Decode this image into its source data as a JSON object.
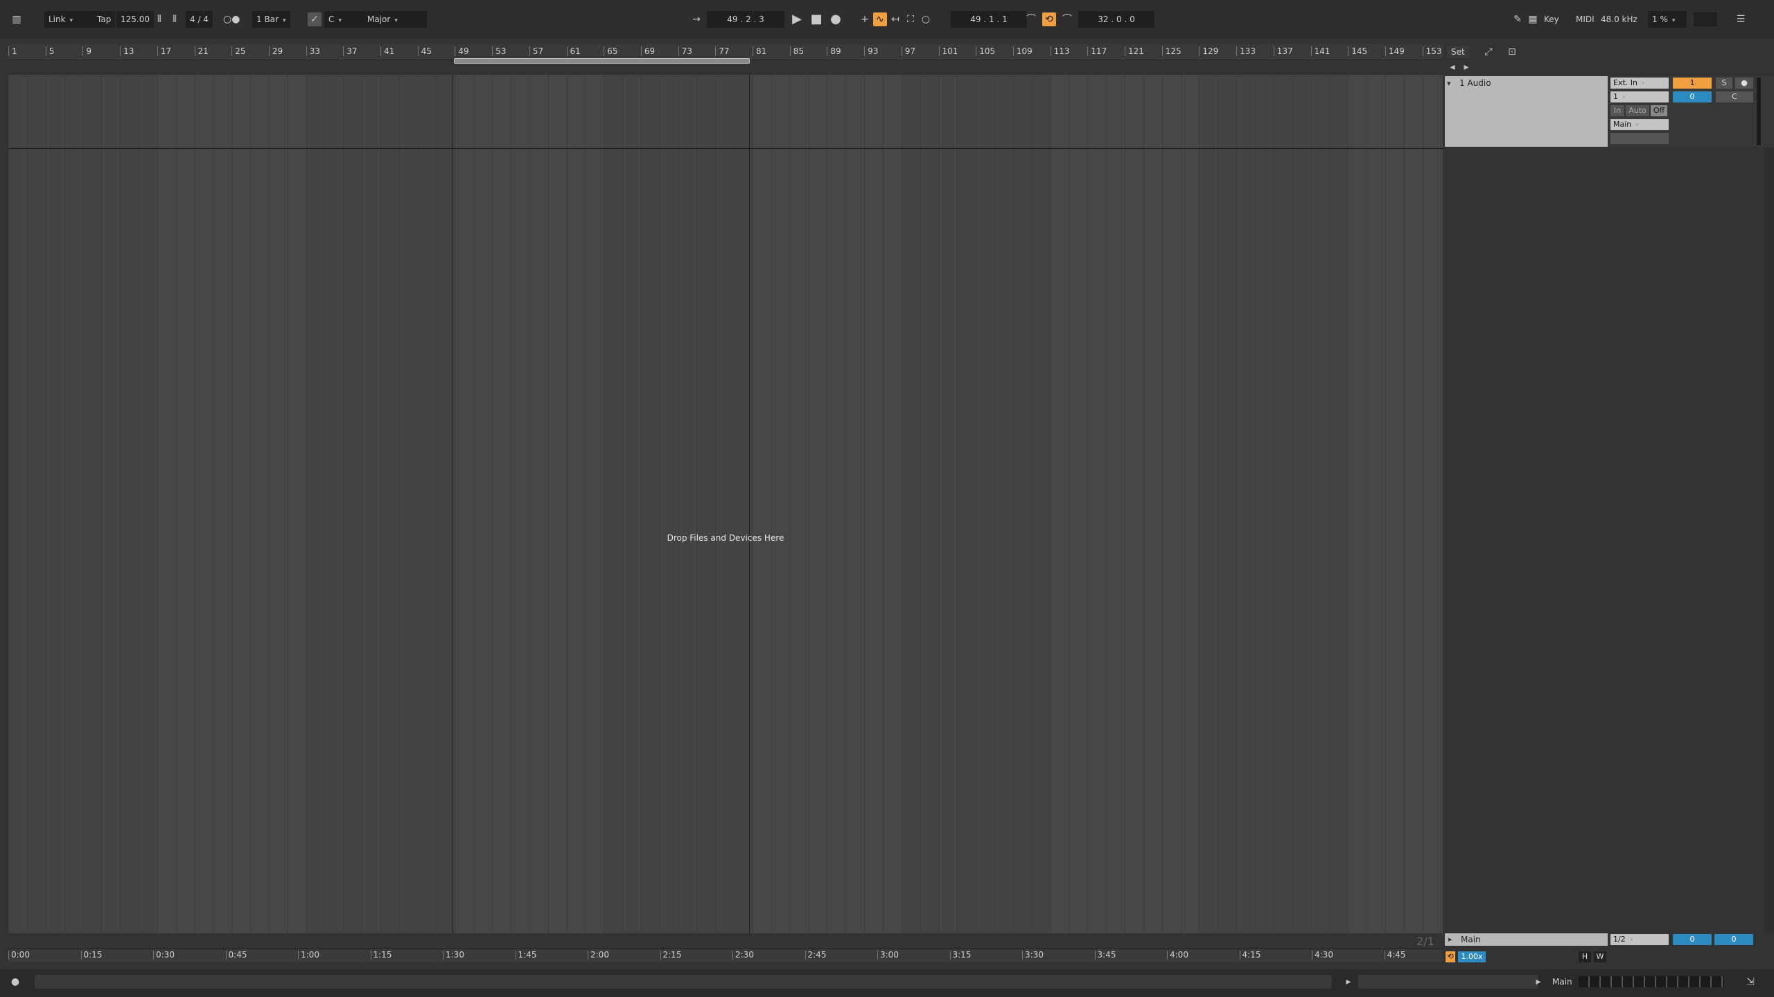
{
  "control_bar": {
    "link": "Link",
    "tap": "Tap",
    "tempo": "125.00",
    "time_signature": "4 / 4",
    "quantize": "1 Bar",
    "key_root": "C",
    "scale": "Major",
    "arrangement_position": "49 .  2 .  3",
    "loop_start": "49 .  1 .  1",
    "loop_length": "32 .  0 .  0",
    "key_map": "Key",
    "midi_map": "MIDI",
    "sample_rate": "48.0 kHz",
    "cpu": "1 %"
  },
  "ruler": {
    "bars": [
      "1",
      "5",
      "9",
      "13",
      "17",
      "21",
      "25",
      "29",
      "33",
      "37",
      "41",
      "45",
      "49",
      "53",
      "57",
      "61",
      "65",
      "69",
      "73",
      "77",
      "81",
      "85",
      "89",
      "93",
      "97",
      "101",
      "105",
      "109",
      "113",
      "117",
      "121",
      "125",
      "129",
      "133",
      "137",
      "141",
      "145",
      "149",
      "153"
    ],
    "set_button": "Set"
  },
  "arrangement": {
    "drop_hint": "Drop Files and Devices Here",
    "grid_zoom": "2/1"
  },
  "track": {
    "name": "1 Audio",
    "input_type": "Ext. In",
    "input_channel": "1",
    "monitor_in": "In",
    "monitor_auto": "Auto",
    "monitor_off": "Off",
    "output": "Main",
    "track_number": "1",
    "solo": "S",
    "volume": "0",
    "pan": "C"
  },
  "main_track": {
    "name": "Main",
    "cue_out": "1/2",
    "volume": "0",
    "pan": "0",
    "tempo_scale": "1.00x",
    "h": "H",
    "w": "W"
  },
  "time_ruler": {
    "times": [
      "0:00",
      "0:15",
      "0:30",
      "0:45",
      "1:00",
      "1:15",
      "1:30",
      "1:45",
      "2:00",
      "2:15",
      "2:30",
      "2:45",
      "3:00",
      "3:15",
      "3:30",
      "3:45",
      "4:00",
      "4:15",
      "4:30",
      "4:45"
    ]
  },
  "status_bar": {
    "selected_track": "Main"
  }
}
